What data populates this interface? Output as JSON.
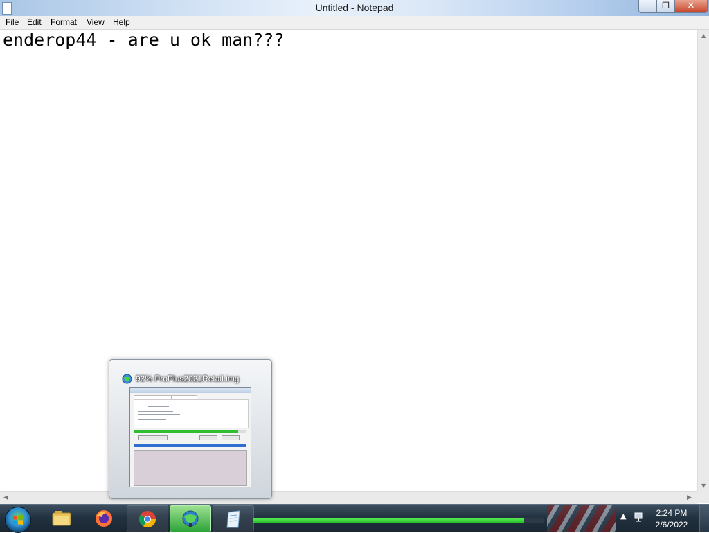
{
  "window": {
    "title": "Untitled - Notepad",
    "controls": {
      "minimize": "—",
      "maximize": "❐",
      "close": "✕"
    }
  },
  "menu": [
    "File",
    "Edit",
    "Format",
    "View",
    "Help"
  ],
  "editor": {
    "text": "enderop44 - are u ok man???"
  },
  "taskbar": {
    "start_label": "Start",
    "pinned": [
      {
        "name": "windows-explorer",
        "icon": "folder-icon"
      },
      {
        "name": "firefox",
        "icon": "firefox-icon"
      },
      {
        "name": "chrome",
        "icon": "chrome-icon"
      },
      {
        "name": "internet-download-manager",
        "icon": "idm-icon",
        "active": true
      },
      {
        "name": "notepad",
        "icon": "notepad-icon"
      }
    ],
    "download_progress": 0.93,
    "clock": {
      "time": "2:24 PM",
      "date": "2/6/2022"
    }
  },
  "thumbnail": {
    "title": "93% ProPlus2021Retail.img",
    "progress": 0.93
  },
  "colors": {
    "accent_green": "#2ea43a",
    "taskbar_dark": "#223241",
    "close_red": "#c8442a"
  }
}
